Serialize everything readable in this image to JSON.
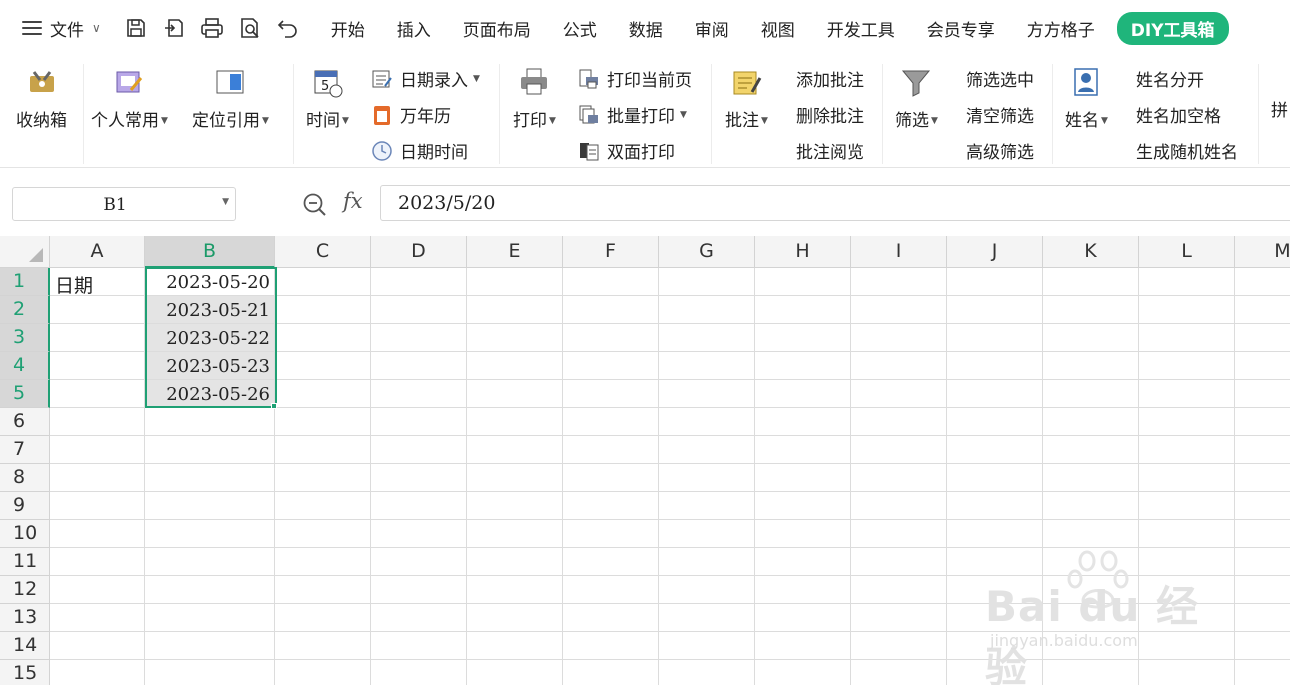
{
  "menubar": {
    "file": "文件",
    "tabs": [
      "开始",
      "插入",
      "页面布局",
      "公式",
      "数据",
      "审阅",
      "视图",
      "开发工具",
      "会员专享",
      "方方格子"
    ],
    "diy_tab": "DIY工具箱",
    "accent_color": "#1fb57b",
    "quick_icons": [
      "save-icon",
      "export-icon",
      "print-icon",
      "print-preview-icon",
      "undo-icon"
    ]
  },
  "ribbon": {
    "storage_box": "收纳箱",
    "personal_common": "个人常用",
    "locate_ref": "定位引用",
    "time": "时间",
    "date_entry": "日期录入",
    "calendar": "万年历",
    "datetime": "日期时间",
    "print": "打印",
    "print_current": "打印当前页",
    "batch_print": "批量打印",
    "duplex_print": "双面打印",
    "comment": "批注",
    "add_comment": "添加批注",
    "delete_comment": "删除批注",
    "view_comment": "批注阅览",
    "filter": "筛选",
    "filter_selected": "筛选选中",
    "clear_filter": "清空筛选",
    "advanced_filter": "高级筛选",
    "name": "姓名",
    "split_name": "姓名分开",
    "name_add_space": "姓名加空格",
    "random_name": "生成随机姓名",
    "pinyin_partial": "拼"
  },
  "formula_bar": {
    "cell_ref": "B1",
    "fx_label": "fx",
    "value": "2023/5/20"
  },
  "grid": {
    "columns": [
      "A",
      "B",
      "C",
      "D",
      "E",
      "F",
      "G",
      "H",
      "I",
      "J",
      "K",
      "L",
      "M"
    ],
    "rows": [
      "1",
      "2",
      "3",
      "4",
      "5",
      "6",
      "7",
      "8",
      "9",
      "10",
      "11",
      "12",
      "13",
      "14",
      "15"
    ],
    "selected_column": "B",
    "selected_rows": [
      "1",
      "2",
      "3",
      "4",
      "5"
    ],
    "cells": {
      "A1": "日期",
      "B1": "2023-05-20",
      "B2": "2023-05-21",
      "B3": "2023-05-22",
      "B4": "2023-05-23",
      "B5": "2023-05-26"
    },
    "selection_color": "#1fa074"
  },
  "watermark": {
    "main": "Bai du 经验",
    "sub": "jingyan.baidu.com"
  }
}
